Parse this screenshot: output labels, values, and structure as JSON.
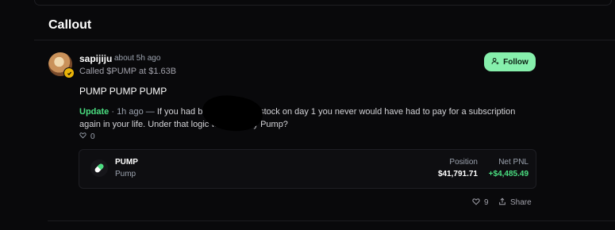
{
  "section": {
    "title": "Callout"
  },
  "post": {
    "username": "sapijiju",
    "time_ago": "about 5h ago",
    "called": "Called $PUMP at $1.63B",
    "follow_label": "Follow",
    "title": "PUMP PUMP PUMP",
    "update": {
      "label": "Update",
      "meta": "· 1h ago —",
      "text": "If you had bought Netflix's stock on day 1 you never would have had to pay for a subscription again in your life. Under that logic why not buy Pump?"
    },
    "update_likes": "0",
    "likes": "9",
    "share_label": "Share"
  },
  "position": {
    "symbol": "PUMP",
    "name": "Pump",
    "position_label": "Position",
    "position_value": "$41,791.71",
    "pnl_label": "Net PNL",
    "pnl_value": "+$4,485.49"
  },
  "colors": {
    "accent_green": "#86efac",
    "profit_green": "#4ade80",
    "background": "#09090b"
  },
  "icons": [
    "verified-badge-icon",
    "user-plus-icon",
    "heart-icon",
    "share-icon",
    "pill-icon"
  ]
}
